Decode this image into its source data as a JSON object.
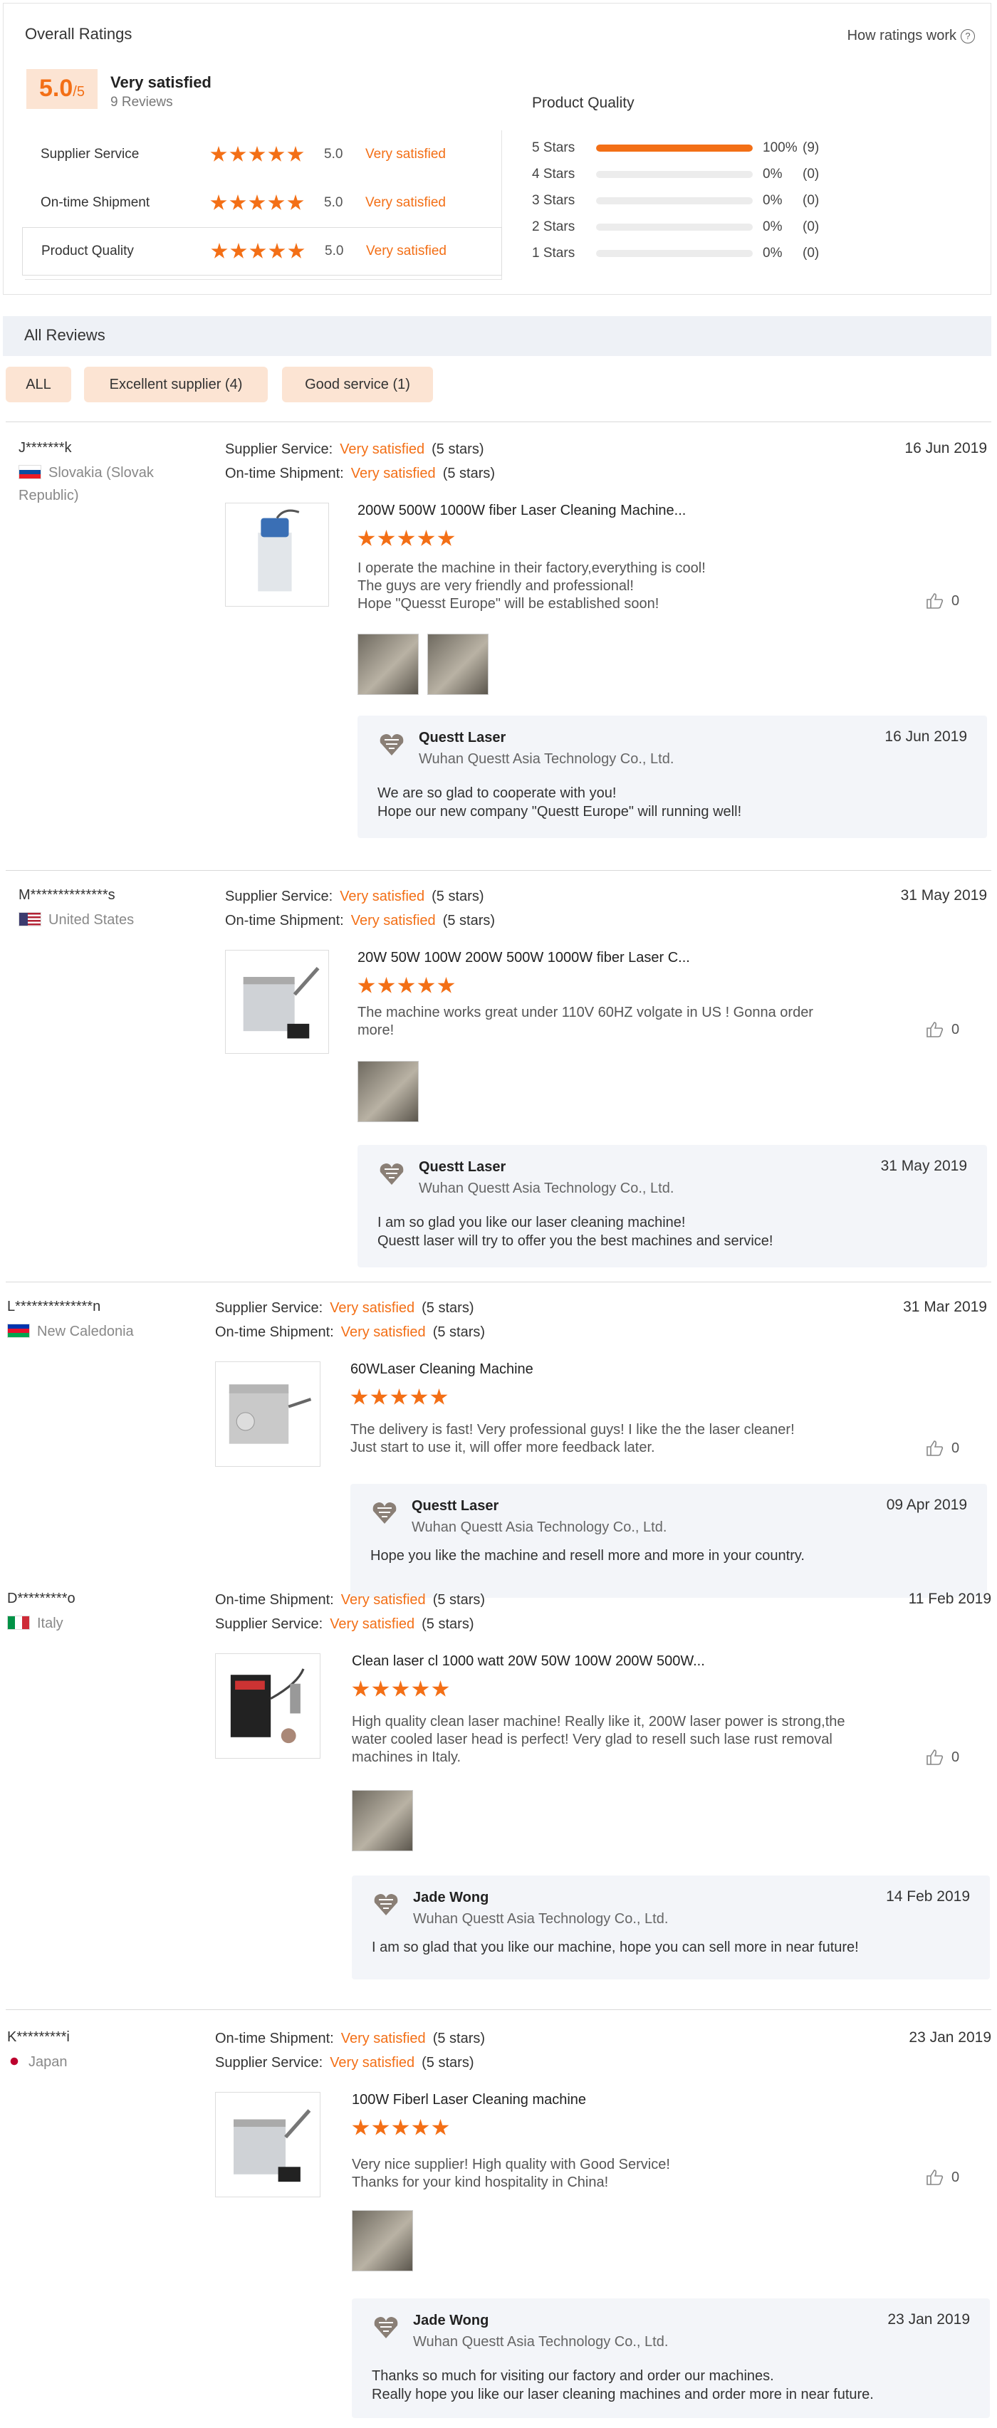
{
  "overall": {
    "title": "Overall Ratings",
    "how_link": "How ratings work",
    "score": "5.0",
    "score_suffix": "/5",
    "satisfaction": "Very satisfied",
    "review_count": "9 Reviews",
    "categories": [
      {
        "label": "Supplier Service",
        "score": "5.0",
        "satisfaction": "Very satisfied",
        "stars": 5
      },
      {
        "label": "On-time Shipment",
        "score": "5.0",
        "satisfaction": "Very satisfied",
        "stars": 5
      },
      {
        "label": "Product Quality",
        "score": "5.0",
        "satisfaction": "Very satisfied",
        "stars": 5
      }
    ],
    "product_quality": {
      "title": "Product Quality",
      "distribution": [
        {
          "label": "5 Stars",
          "percent_text": "100%",
          "count_text": "(9)",
          "fraction": 1.0
        },
        {
          "label": "4 Stars",
          "percent_text": "0%",
          "count_text": "(0)",
          "fraction": 0
        },
        {
          "label": "3 Stars",
          "percent_text": "0%",
          "count_text": "(0)",
          "fraction": 0
        },
        {
          "label": "2 Stars",
          "percent_text": "0%",
          "count_text": "(0)",
          "fraction": 0
        },
        {
          "label": "1 Stars",
          "percent_text": "0%",
          "count_text": "(0)",
          "fraction": 0
        }
      ]
    }
  },
  "all_reviews": {
    "title": "All Reviews",
    "filters": [
      "ALL",
      "Excellent supplier (4)",
      "Good service (1)"
    ]
  },
  "reviews": [
    {
      "user": "J*******k",
      "country": "Slovakia (Slovak Republic)",
      "meta": [
        {
          "label": "Supplier Service:",
          "value": "Very satisfied",
          "stars": "(5 stars)"
        },
        {
          "label": "On-time Shipment:",
          "value": "Very satisfied",
          "stars": "(5 stars)"
        }
      ],
      "date": "16 Jun 2019",
      "product": "200W 500W 1000W fiber Laser Cleaning Machine...",
      "rating": 5,
      "text": [
        "I operate the machine in their factory,everything is cool!",
        "The guys are very friendly and professional!",
        "Hope \"Quesst Europe\" will be established soon!"
      ],
      "likes": "0",
      "reply": {
        "name": "Questt Laser",
        "company": "Wuhan Questt Asia Technology Co., Ltd.",
        "date": "16 Jun 2019",
        "text": [
          "We are so glad to cooperate with you!",
          "Hope our new company \"Questt Europe\" will running well!"
        ]
      }
    },
    {
      "user": "M**************s",
      "country": "United States",
      "meta": [
        {
          "label": "Supplier Service:",
          "value": "Very satisfied",
          "stars": "(5 stars)"
        },
        {
          "label": "On-time Shipment:",
          "value": "Very satisfied",
          "stars": "(5 stars)"
        }
      ],
      "date": "31 May 2019",
      "product": "20W 50W 100W 200W 500W 1000W fiber Laser C...",
      "rating": 5,
      "text": [
        "The machine works great under 110V 60HZ volgate in US ! Gonna order",
        "more!"
      ],
      "likes": "0",
      "reply": {
        "name": "Questt Laser",
        "company": "Wuhan Questt Asia Technology Co., Ltd.",
        "date": "31 May 2019",
        "text": [
          "I am so glad you like our laser cleaning machine!",
          "Questt laser will try to offer you the best machines and service!"
        ]
      }
    },
    {
      "user": "L**************n",
      "country": "New Caledonia",
      "meta": [
        {
          "label": "Supplier Service:",
          "value": "Very satisfied",
          "stars": "(5 stars)"
        },
        {
          "label": "On-time Shipment:",
          "value": "Very satisfied",
          "stars": "(5 stars)"
        }
      ],
      "date": "31 Mar 2019",
      "product": "60WLaser Cleaning Machine",
      "rating": 5,
      "text": [
        "The delivery is fast! Very professional guys! I like the the laser cleaner!",
        "Just start to use it, will offer more feedback later."
      ],
      "likes": "0",
      "reply": {
        "name": "Questt Laser",
        "company": "Wuhan Questt Asia Technology Co., Ltd.",
        "date": "09 Apr 2019",
        "text": [
          "Hope you like the machine and resell more and more in your country."
        ]
      }
    },
    {
      "user": "D*********o",
      "country": "Italy",
      "meta": [
        {
          "label": "On-time Shipment:",
          "value": "Very satisfied",
          "stars": "(5 stars)"
        },
        {
          "label": "Supplier Service:",
          "value": "Very satisfied",
          "stars": "(5 stars)"
        }
      ],
      "date": "11 Feb 2019",
      "product": "Clean laser cl 1000 watt 20W 50W 100W 200W 500W...",
      "rating": 5,
      "text": [
        "High quality clean laser machine! Really like it, 200W laser power is strong,the",
        "water cooled laser head is perfect! Very glad to resell such lase rust removal",
        "machines in Italy."
      ],
      "likes": "0",
      "reply": {
        "name": "Jade Wong",
        "company": "Wuhan Questt Asia Technology Co., Ltd.",
        "date": "14 Feb 2019",
        "text": [
          "I am so glad that you like our machine, hope you can sell more in near future!"
        ]
      }
    },
    {
      "user": "K*********i",
      "country": "Japan",
      "meta": [
        {
          "label": "On-time Shipment:",
          "value": "Very satisfied",
          "stars": "(5 stars)"
        },
        {
          "label": "Supplier Service:",
          "value": "Very satisfied",
          "stars": "(5 stars)"
        }
      ],
      "date": "23 Jan 2019",
      "product": "100W Fiberl Laser Cleaning machine",
      "rating": 5,
      "text": [
        "Very nice supplier! High quality with Good Service!",
        "Thanks for your kind hospitality in China!"
      ],
      "likes": "0",
      "reply": {
        "name": "Jade Wong",
        "company": "Wuhan Questt Asia Technology Co., Ltd.",
        "date": "23 Jan 2019",
        "text": [
          "Thanks so much for visiting our factory and order our machines.",
          "Really hope you like our laser cleaning machines and order more in near future."
        ]
      }
    }
  ],
  "colors": {
    "accent": "#f36f16",
    "badge_bg": "#fce4d3",
    "reply_bg": "#f3f5f9",
    "header_bg": "#eef1f6"
  }
}
